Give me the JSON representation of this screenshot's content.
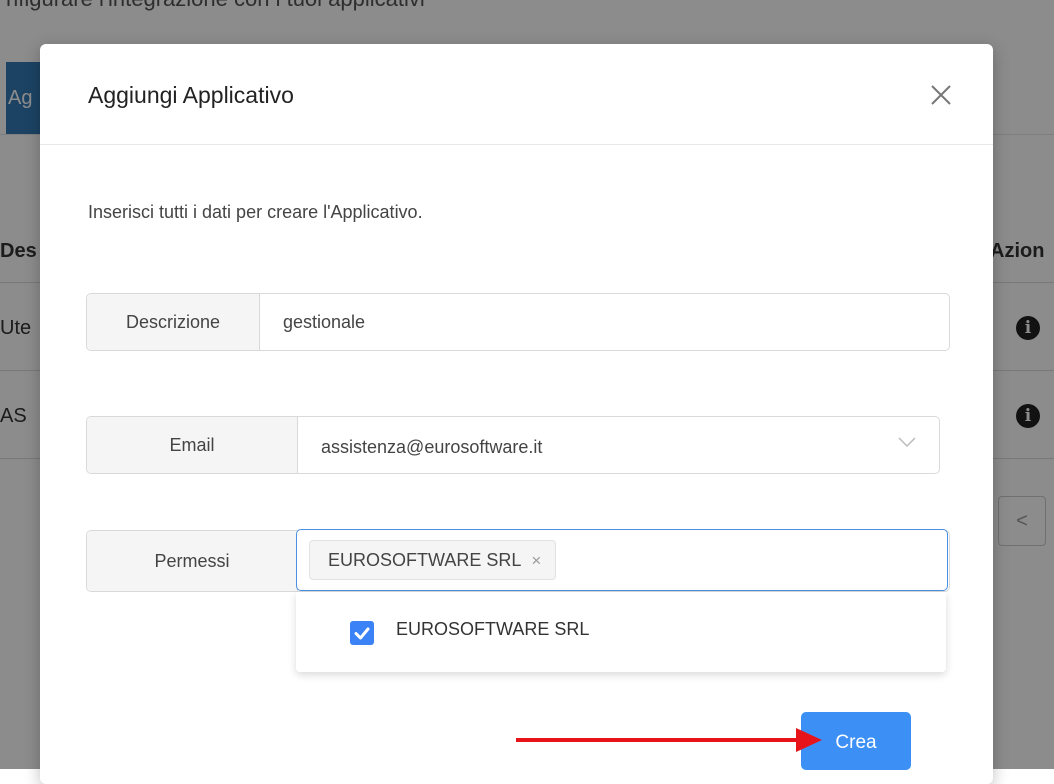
{
  "background": {
    "heading": "nfigurare l'integrazione con i tuoi applicativi",
    "active_tab_fragment": "Ag",
    "column_left": "Des",
    "column_right": "Azion",
    "rows": [
      {
        "text": "Ute"
      },
      {
        "text": "AS"
      }
    ],
    "pager_prev": "<"
  },
  "modal": {
    "title": "Aggiungi Applicativo",
    "intro": "Inserisci tutti i dati per creare l'Applicativo.",
    "fields": {
      "description": {
        "label": "Descrizione",
        "value": "gestionale"
      },
      "email": {
        "label": "Email",
        "value": "assistenza@eurosoftware.it"
      },
      "permissions": {
        "label": "Permessi",
        "selected_tag": "EUROSOFTWARE SRL",
        "tag_remove": "×",
        "options": [
          {
            "label": "EUROSOFTWARE SRL",
            "checked": true
          }
        ]
      }
    },
    "submit_label": "Crea"
  },
  "annotation": {
    "arrow_color": "#e8141b"
  },
  "colors": {
    "primary": "#3b8ff5",
    "focus_border": "#4a90e2",
    "checkbox": "#3b82f6"
  }
}
